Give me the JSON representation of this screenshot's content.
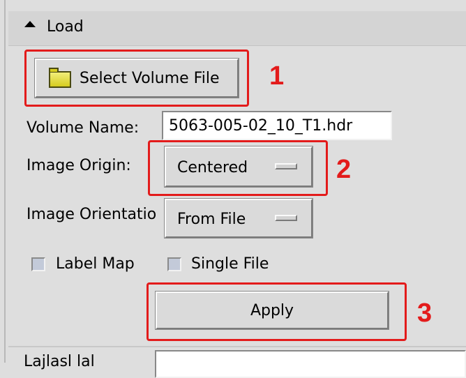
{
  "panel": {
    "section_title": "Load",
    "select_button_label": "Select Volume File",
    "volume_name_label": "Volume Name:",
    "volume_name_value": "5063-005-02_10_T1.hdr",
    "image_origin_label": "Image Origin:",
    "image_origin_value": "Centered",
    "image_orientation_label": "Image Orientatio",
    "image_orientation_value": "From File",
    "label_map_label": "Label Map",
    "single_file_label": "Single File",
    "apply_label": "Apply",
    "bottom_label": "Lajlasl lal"
  },
  "annotations": {
    "step1": "1",
    "step2": "2",
    "step3": "3",
    "color": "#e31b1b"
  },
  "icons": {
    "collapse": "triangle-up-icon",
    "folder": "folder-icon"
  }
}
